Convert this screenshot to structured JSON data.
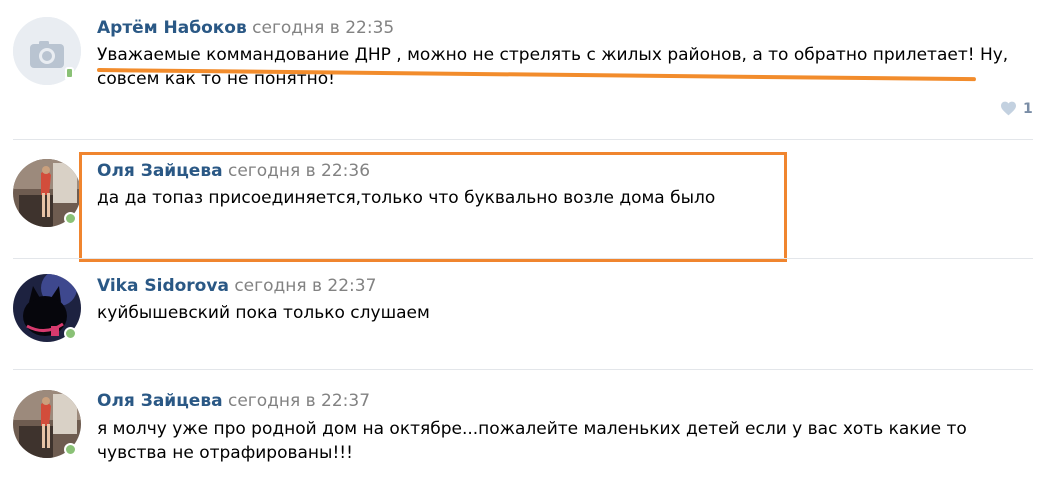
{
  "comments": [
    {
      "author": "Артём Набоков",
      "time": "сегодня в 22:35",
      "text": "Уважаемые коммандование ДНР , можно не стрелять с жилых районов, а то обратно прилетает! Ну, совсем как то не понятно!",
      "likes": "1",
      "avatar": "camera-placeholder",
      "online": "mobile"
    },
    {
      "author": "Оля Зайцева",
      "time": "сегодня в 22:36",
      "text": "да да топаз присоединяется,только что буквально возле дома было",
      "avatar": "photo",
      "online": "web"
    },
    {
      "author": "Vika Sidorova",
      "time": "сегодня в 22:37",
      "text": "куйбышевский пока только слушаем",
      "avatar": "photo",
      "online": "web"
    },
    {
      "author": "Оля Зайцева",
      "time": "сегодня в 22:37",
      "text": "я молчу уже про родной дом на октябре...пожалейте маленьких детей если у вас хоть какие то чувства не отрафированы!!!",
      "avatar": "photo",
      "online": "web"
    }
  ],
  "icons": {
    "like": "heart-icon",
    "camera": "camera-icon"
  },
  "colors": {
    "author": "#2a5885",
    "timestamp": "#828282",
    "online": "#8ac176",
    "annotation": "#f0852f"
  }
}
